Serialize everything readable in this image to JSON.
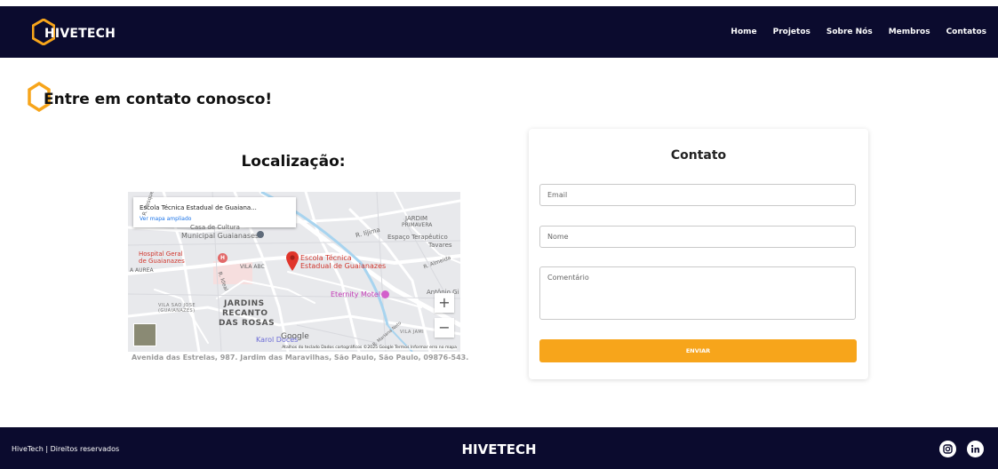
{
  "header": {
    "logo_text": "HIVETECH",
    "nav": [
      "Home",
      "Projetos",
      "Sobre Nós",
      "Membros",
      "Contatos"
    ]
  },
  "page": {
    "heading": "Entre em contato conosco!"
  },
  "location": {
    "title": "Localização:",
    "map": {
      "card_title": "Escola Técnica Estadual de Guaiana...",
      "card_link": "Ver mapa ampliado",
      "labels": {
        "escola": "Escola Técnica",
        "escola_2": "Estadual de Guaianazes",
        "hospital": "Hospital Geral",
        "hospital_2": "de Guaianazes",
        "casa_cultura": "Casa de Cultura",
        "casa_cultura_2": "Municipal Guaianases",
        "espaco": "Espaço Terapêutico",
        "tavares": "Tavares",
        "jardim_primavera": "JARDIM",
        "jardim_primavera_2": "PRIMAVERA",
        "eternity": "Eternity Motel",
        "antonio": "Antônio Gi",
        "jardins": "JARDINS",
        "recanto": "RECANTO",
        "das_rosas": "DAS ROSAS",
        "vila_sao_jose": "VILA SAO JOSE",
        "guaianazes": "(GUAIANAZES)",
        "vila_abc": "VILA ABC",
        "aurea": "A AUREA",
        "vila_jami": "VILA JAMI",
        "karol": "Karol Doces",
        "r_iijima": "R. Iijima",
        "r_almeida": "R. Almeida",
        "r_pesqueira": "R. Pesqueira",
        "r_ideal": "R. Ideal",
        "r_mariana": "R. Mariana Neto"
      },
      "zoom_in": "+",
      "zoom_out": "−",
      "google": "Google",
      "attribution": "Atalhos do teclado   Dados cartográficos ©2025 Google   Termos   Informar erro no mapa"
    },
    "address": "Avenida das Estrelas, 987. Jardim das Maravilhas, São Paulo, São Paulo, 09876-543."
  },
  "contact_form": {
    "title": "Contato",
    "email_placeholder": "Email",
    "name_placeholder": "Nome",
    "comment_placeholder": "Comentário",
    "submit": "ENVIAR"
  },
  "footer": {
    "left": "HiveTech | Direitos reservados",
    "brand": "HIVETECH",
    "social": [
      "instagram-icon",
      "linkedin-icon"
    ]
  },
  "colors": {
    "navy": "#0b0b2e",
    "accent": "#f7a51b",
    "map_pin": "#e0352b"
  }
}
